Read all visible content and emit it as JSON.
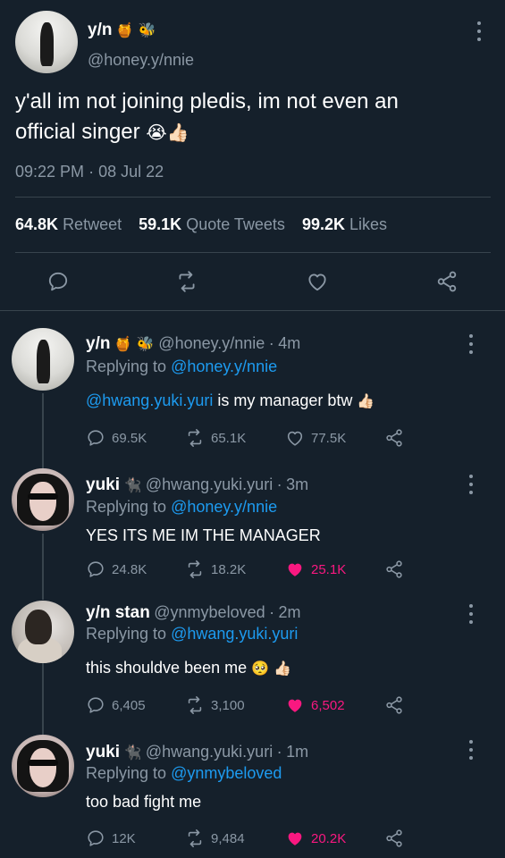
{
  "main_tweet": {
    "name": "y/n",
    "name_emojis": "🍯 🐝",
    "handle": "@honey.y/nnie",
    "text_line1": "y'all im not joining pledis, im not even an",
    "text_line2": "official singer",
    "text_emojis": "😭👍🏻",
    "time": "09:22 PM",
    "date": "08 Jul 22",
    "stats": {
      "retweets_count": "64.8K",
      "retweets_label": "Retweet",
      "quotes_count": "59.1K",
      "quotes_label": "Quote Tweets",
      "likes_count": "99.2K",
      "likes_label": "Likes"
    }
  },
  "replies": [
    {
      "name": "y/n",
      "name_emojis": "🍯 🐝",
      "handle": "@honey.y/nnie",
      "age": "4m",
      "replying_prefix": "Replying to",
      "replying_to": "@honey.y/nnie",
      "mention": "@hwang.yuki.yuri",
      "text": " is my manager btw",
      "text_emojis": "👍🏻",
      "replies": "69.5K",
      "retweets": "65.1K",
      "likes": "77.5K"
    },
    {
      "name": "yuki",
      "name_emojis": "🐈‍⬛",
      "handle": "@hwang.yuki.yuri",
      "age": "3m",
      "replying_prefix": "Replying to",
      "replying_to": "@honey.y/nnie",
      "text": "YES ITS ME IM THE MANAGER",
      "replies": "24.8K",
      "retweets": "18.2K",
      "likes": "25.1K"
    },
    {
      "name": "y/n stan",
      "handle": "@ynmybeloved",
      "age": "2m",
      "replying_prefix": "Replying to",
      "replying_to": "@hwang.yuki.yuri",
      "text": "this shouldve been me",
      "text_emojis": "🥺 👍🏻",
      "replies": "6,405",
      "retweets": "3,100",
      "likes": "6,502"
    },
    {
      "name": "yuki",
      "name_emojis": "🐈‍⬛",
      "handle": "@hwang.yuki.yuri",
      "age": "1m",
      "replying_prefix": "Replying to",
      "replying_to": "@ynmybeloved",
      "text": "too bad fight me",
      "replies": "12K",
      "retweets": "9,484",
      "likes": "20.2K"
    }
  ],
  "separator": "·",
  "colors": {
    "background": "#15202b",
    "muted": "#8b98a5",
    "link": "#1d9bf0",
    "like": "#f91880",
    "divider": "#38444d"
  },
  "icons": [
    "more-icon",
    "reply-icon",
    "retweet-icon",
    "like-icon",
    "share-icon"
  ]
}
